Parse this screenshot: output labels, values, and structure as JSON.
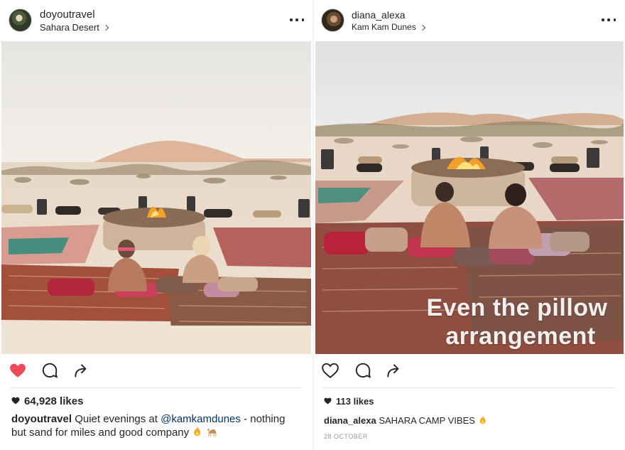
{
  "left_post": {
    "username": "doyoutravel",
    "location": "Sahara Desert",
    "likes": "64,928 likes",
    "liked": true,
    "caption": {
      "user": "doyoutravel",
      "text_before": " Quiet evenings at ",
      "mention": "@kamkamdunes",
      "text_after": " - nothing but sand for miles and good company "
    },
    "icons": [
      "more-icon",
      "heart-icon",
      "comment-icon",
      "share-icon",
      "fire-emoji",
      "camel-emoji"
    ]
  },
  "right_post": {
    "username": "diana_alexa",
    "location": "Kam Kam Dunes",
    "overlay_line1": "Even the pillow",
    "overlay_line2": "arrangement",
    "likes": "113 likes",
    "liked": false,
    "caption": {
      "user": "diana_alexa",
      "text": " SAHARA CAMP VIBES "
    },
    "date": "28 OCTOBER",
    "icons": [
      "more-icon",
      "heart-icon",
      "comment-icon",
      "share-icon",
      "fire-emoji"
    ]
  },
  "colors": {
    "liked_heart": "#ed4956",
    "text": "#262626",
    "mention": "#003569",
    "muted": "#999999",
    "background": "#f2f2f2"
  }
}
